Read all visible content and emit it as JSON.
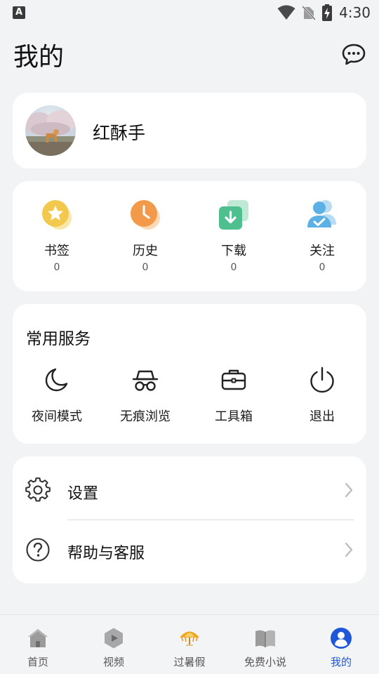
{
  "status_bar": {
    "time": "4:30",
    "indicator": "A"
  },
  "header": {
    "title": "我的",
    "message_icon": "chat-bubble-icon"
  },
  "profile": {
    "username": "红酥手",
    "avatar_icon": "dog-photo-avatar"
  },
  "stats": [
    {
      "label": "书签",
      "count": "0",
      "icon": "star-icon",
      "color": "#f2c94c"
    },
    {
      "label": "历史",
      "count": "0",
      "icon": "clock-icon",
      "color": "#f2994a"
    },
    {
      "label": "下载",
      "count": "0",
      "icon": "download-icon",
      "color": "#4fbf8f"
    },
    {
      "label": "关注",
      "count": "0",
      "icon": "follow-user-icon",
      "color": "#5bb0e6"
    }
  ],
  "services": {
    "title": "常用服务",
    "items": [
      {
        "label": "夜间模式",
        "icon": "moon-icon"
      },
      {
        "label": "无痕浏览",
        "icon": "incognito-icon"
      },
      {
        "label": "工具箱",
        "icon": "toolbox-icon"
      },
      {
        "label": "退出",
        "icon": "power-icon"
      }
    ]
  },
  "list": [
    {
      "label": "设置",
      "icon": "gear-icon"
    },
    {
      "label": "帮助与客服",
      "icon": "help-icon"
    }
  ],
  "bottom_nav": {
    "active": "我的",
    "active_color": "#1f57d8",
    "items": [
      {
        "label": "首页",
        "icon": "home-icon"
      },
      {
        "label": "视频",
        "icon": "video-icon"
      },
      {
        "label": "过暑假",
        "icon": "parasol-icon"
      },
      {
        "label": "免费小说",
        "icon": "book-icon"
      },
      {
        "label": "我的",
        "icon": "profile-icon"
      }
    ]
  }
}
